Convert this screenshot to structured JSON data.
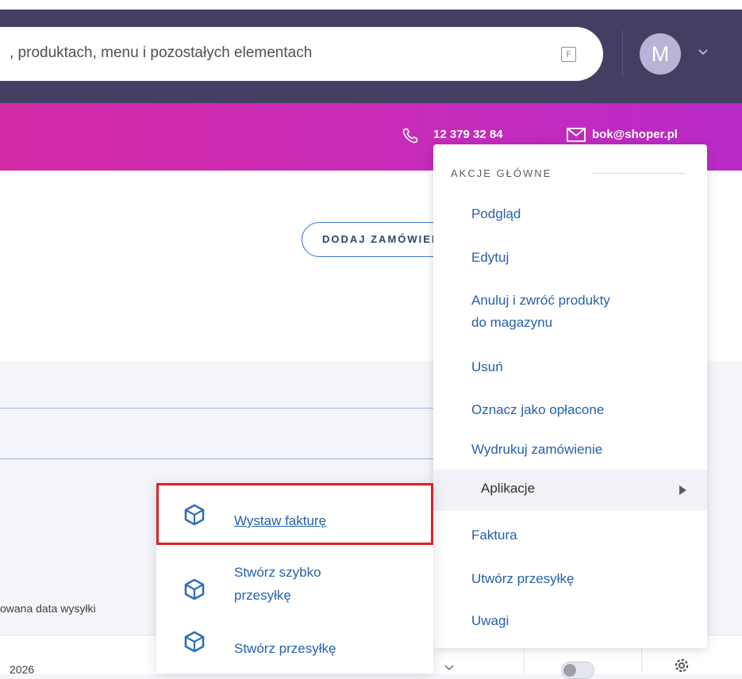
{
  "header": {
    "search_text": ", produktach, menu i pozostałych elementach",
    "shortcut_key": "F",
    "avatar_initial": "M"
  },
  "contact": {
    "phone": "12 379 32 84",
    "email": "bok@shoper.pl"
  },
  "page": {
    "add_order_label": "DODAJ ZAMÓWIENIE",
    "ship_date_label": "owana data wysyłki",
    "year_text": "2026"
  },
  "actions_menu": {
    "section_title": "AKCJE GŁÓWNE",
    "items": [
      "Podgląd",
      "Edytuj",
      "Anuluj i zwróć produkty",
      "do magazynu",
      "Usuń",
      "Oznacz jako opłacone",
      "Wydrukuj zamówienie",
      "Aplikacje",
      "Faktura",
      "Utwórz przesyłkę",
      "Uwagi"
    ]
  },
  "apps_submenu": {
    "items": [
      "Wystaw fakturę",
      "Stwórz szybko",
      "przesyłkę",
      "Stwórz przesyłkę"
    ]
  },
  "colors": {
    "topbar": "#443e62",
    "brand_gradient_start": "#d32aa6",
    "brand_gradient_end": "#b92ac6",
    "link": "#2660ad",
    "highlight_border": "#e01f27"
  },
  "icons": [
    "phone-icon",
    "mail-icon",
    "chevron-down-icon",
    "gear-icon",
    "cube-app-icon",
    "submenu-arrow-icon"
  ]
}
